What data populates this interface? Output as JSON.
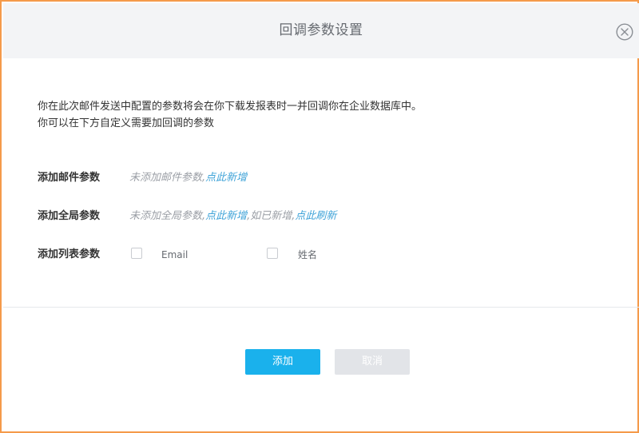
{
  "dialog": {
    "title": "回调参数设置"
  },
  "intro": {
    "line1": "你在此次邮件发送中配置的参数将会在你下载发报表时一并回调你在企业数据库中。",
    "line2": "你可以在下方自定义需要加回调的参数"
  },
  "mail_params": {
    "label": "添加邮件参数",
    "empty_text": "未添加邮件参数,",
    "add_link": "点此新增"
  },
  "global_params": {
    "label": "添加全局参数",
    "empty_text": "未添加全局参数,",
    "add_link": "点此新增",
    "added_text": ",如已新增,",
    "refresh_link": "点此刷新"
  },
  "list_params": {
    "label": "添加列表参数",
    "options": [
      {
        "label": "Email",
        "checked": false
      },
      {
        "label": "姓名",
        "checked": false
      }
    ]
  },
  "buttons": {
    "add": "添加",
    "cancel": "取消"
  },
  "colors": {
    "border": "#f59a4a",
    "header_bg": "#f3f4f6",
    "link": "#3fa3d8",
    "primary": "#1ab1ec",
    "disabled": "#e2e4e8"
  },
  "icons": {
    "close": "close-circle-icon"
  }
}
